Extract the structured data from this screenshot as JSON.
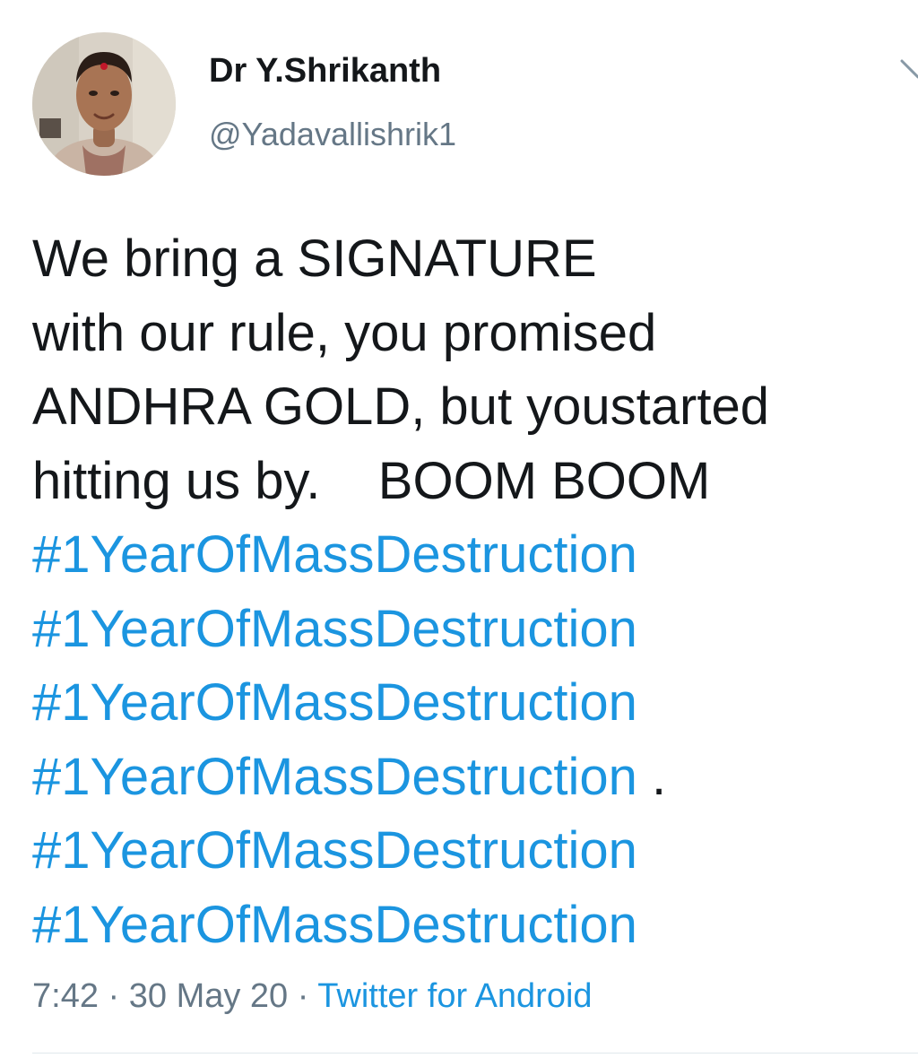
{
  "author": {
    "display_name": "Dr Y.Shrikanth",
    "handle": "@Yadavallishrik1",
    "avatar_icon": "profile-photo"
  },
  "tweet": {
    "lines": [
      "We bring a SIGNATURE",
      "with our rule, you promised",
      "ANDHRA GOLD, but youstarted",
      "hitting us by.    BOOM BOOM"
    ],
    "hashtags": [
      "#1YearOfMassDestruction",
      "#1YearOfMassDestruction",
      "#1YearOfMassDestruction",
      "#1YearOfMassDestruction",
      "#1YearOfMassDestruction",
      "#1YearOfMassDestruction"
    ],
    "hashtag_trailer": " .",
    "time": "7:42",
    "separator": " · ",
    "date": "30 May 20",
    "source": "Twitter for Android"
  },
  "icons": {
    "more": "chevron-down-icon"
  },
  "colors": {
    "text": "#14171a",
    "muted": "#657786",
    "link": "#1b95e0",
    "divider": "#e1e8ed"
  }
}
